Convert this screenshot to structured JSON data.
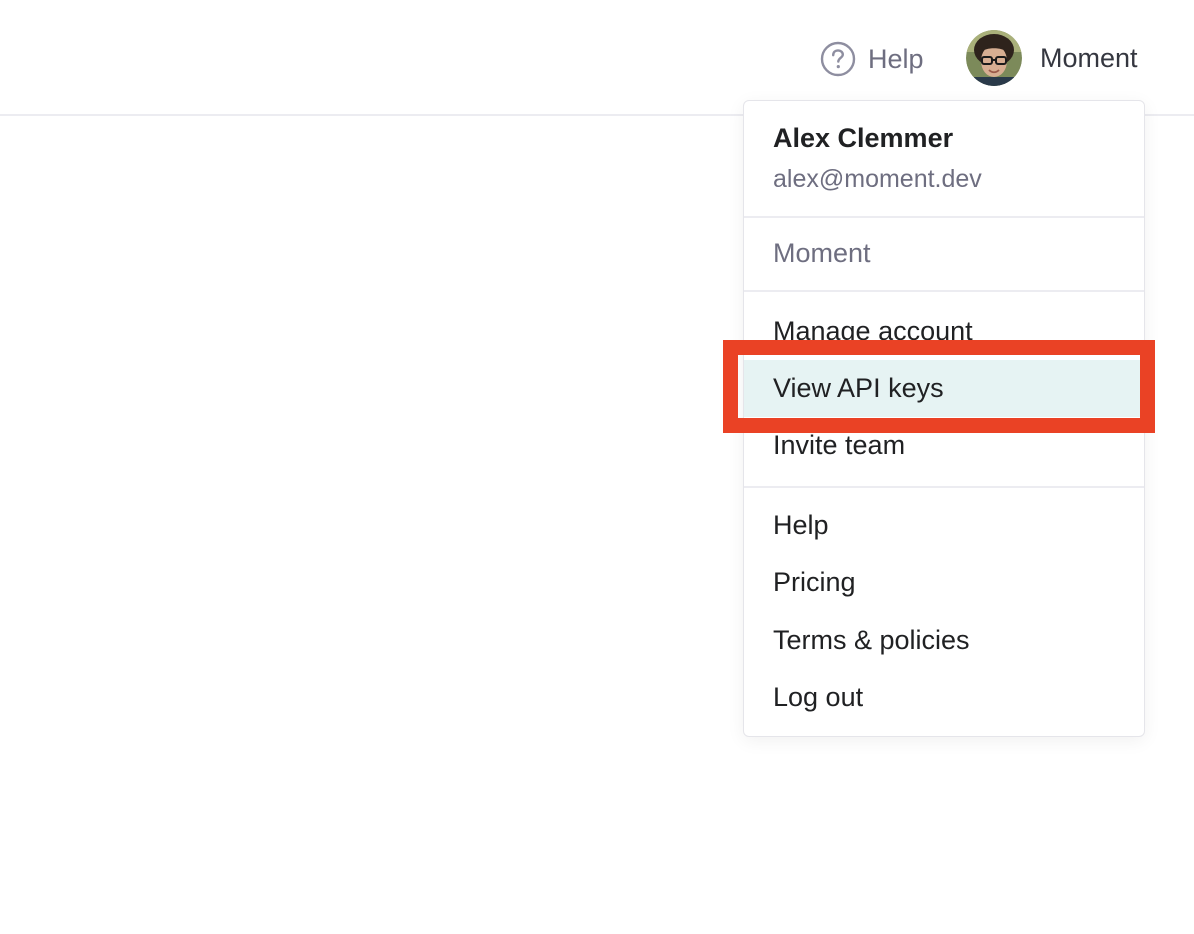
{
  "header": {
    "help_label": "Help",
    "account_label": "Moment",
    "help_icon": "question-circle-icon"
  },
  "menu": {
    "user_name": "Alex Clemmer",
    "user_email": "alex@moment.dev",
    "org_name": "Moment",
    "items": [
      {
        "label": "Manage account"
      },
      {
        "label": "View API keys",
        "active": true
      },
      {
        "label": "Invite team"
      }
    ],
    "footer_items": [
      {
        "label": "Help"
      },
      {
        "label": "Pricing"
      },
      {
        "label": "Terms & policies"
      },
      {
        "label": "Log out"
      }
    ]
  },
  "colors": {
    "highlight": "#ea4225",
    "active_item_bg": "#e6f3f3",
    "text_primary": "#202123",
    "text_secondary": "#6e6e80"
  }
}
